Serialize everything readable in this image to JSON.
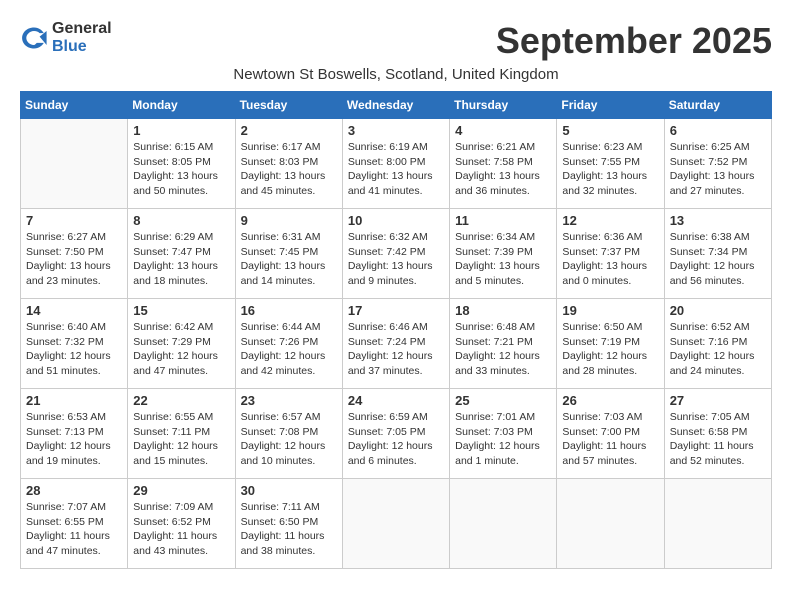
{
  "header": {
    "logo_general": "General",
    "logo_blue": "Blue",
    "month_title": "September 2025",
    "subtitle": "Newtown St Boswells, Scotland, United Kingdom"
  },
  "days_of_week": [
    "Sunday",
    "Monday",
    "Tuesday",
    "Wednesday",
    "Thursday",
    "Friday",
    "Saturday"
  ],
  "weeks": [
    [
      {
        "day": "",
        "info": ""
      },
      {
        "day": "1",
        "info": "Sunrise: 6:15 AM\nSunset: 8:05 PM\nDaylight: 13 hours\nand 50 minutes."
      },
      {
        "day": "2",
        "info": "Sunrise: 6:17 AM\nSunset: 8:03 PM\nDaylight: 13 hours\nand 45 minutes."
      },
      {
        "day": "3",
        "info": "Sunrise: 6:19 AM\nSunset: 8:00 PM\nDaylight: 13 hours\nand 41 minutes."
      },
      {
        "day": "4",
        "info": "Sunrise: 6:21 AM\nSunset: 7:58 PM\nDaylight: 13 hours\nand 36 minutes."
      },
      {
        "day": "5",
        "info": "Sunrise: 6:23 AM\nSunset: 7:55 PM\nDaylight: 13 hours\nand 32 minutes."
      },
      {
        "day": "6",
        "info": "Sunrise: 6:25 AM\nSunset: 7:52 PM\nDaylight: 13 hours\nand 27 minutes."
      }
    ],
    [
      {
        "day": "7",
        "info": "Sunrise: 6:27 AM\nSunset: 7:50 PM\nDaylight: 13 hours\nand 23 minutes."
      },
      {
        "day": "8",
        "info": "Sunrise: 6:29 AM\nSunset: 7:47 PM\nDaylight: 13 hours\nand 18 minutes."
      },
      {
        "day": "9",
        "info": "Sunrise: 6:31 AM\nSunset: 7:45 PM\nDaylight: 13 hours\nand 14 minutes."
      },
      {
        "day": "10",
        "info": "Sunrise: 6:32 AM\nSunset: 7:42 PM\nDaylight: 13 hours\nand 9 minutes."
      },
      {
        "day": "11",
        "info": "Sunrise: 6:34 AM\nSunset: 7:39 PM\nDaylight: 13 hours\nand 5 minutes."
      },
      {
        "day": "12",
        "info": "Sunrise: 6:36 AM\nSunset: 7:37 PM\nDaylight: 13 hours\nand 0 minutes."
      },
      {
        "day": "13",
        "info": "Sunrise: 6:38 AM\nSunset: 7:34 PM\nDaylight: 12 hours\nand 56 minutes."
      }
    ],
    [
      {
        "day": "14",
        "info": "Sunrise: 6:40 AM\nSunset: 7:32 PM\nDaylight: 12 hours\nand 51 minutes."
      },
      {
        "day": "15",
        "info": "Sunrise: 6:42 AM\nSunset: 7:29 PM\nDaylight: 12 hours\nand 47 minutes."
      },
      {
        "day": "16",
        "info": "Sunrise: 6:44 AM\nSunset: 7:26 PM\nDaylight: 12 hours\nand 42 minutes."
      },
      {
        "day": "17",
        "info": "Sunrise: 6:46 AM\nSunset: 7:24 PM\nDaylight: 12 hours\nand 37 minutes."
      },
      {
        "day": "18",
        "info": "Sunrise: 6:48 AM\nSunset: 7:21 PM\nDaylight: 12 hours\nand 33 minutes."
      },
      {
        "day": "19",
        "info": "Sunrise: 6:50 AM\nSunset: 7:19 PM\nDaylight: 12 hours\nand 28 minutes."
      },
      {
        "day": "20",
        "info": "Sunrise: 6:52 AM\nSunset: 7:16 PM\nDaylight: 12 hours\nand 24 minutes."
      }
    ],
    [
      {
        "day": "21",
        "info": "Sunrise: 6:53 AM\nSunset: 7:13 PM\nDaylight: 12 hours\nand 19 minutes."
      },
      {
        "day": "22",
        "info": "Sunrise: 6:55 AM\nSunset: 7:11 PM\nDaylight: 12 hours\nand 15 minutes."
      },
      {
        "day": "23",
        "info": "Sunrise: 6:57 AM\nSunset: 7:08 PM\nDaylight: 12 hours\nand 10 minutes."
      },
      {
        "day": "24",
        "info": "Sunrise: 6:59 AM\nSunset: 7:05 PM\nDaylight: 12 hours\nand 6 minutes."
      },
      {
        "day": "25",
        "info": "Sunrise: 7:01 AM\nSunset: 7:03 PM\nDaylight: 12 hours\nand 1 minute."
      },
      {
        "day": "26",
        "info": "Sunrise: 7:03 AM\nSunset: 7:00 PM\nDaylight: 11 hours\nand 57 minutes."
      },
      {
        "day": "27",
        "info": "Sunrise: 7:05 AM\nSunset: 6:58 PM\nDaylight: 11 hours\nand 52 minutes."
      }
    ],
    [
      {
        "day": "28",
        "info": "Sunrise: 7:07 AM\nSunset: 6:55 PM\nDaylight: 11 hours\nand 47 minutes."
      },
      {
        "day": "29",
        "info": "Sunrise: 7:09 AM\nSunset: 6:52 PM\nDaylight: 11 hours\nand 43 minutes."
      },
      {
        "day": "30",
        "info": "Sunrise: 7:11 AM\nSunset: 6:50 PM\nDaylight: 11 hours\nand 38 minutes."
      },
      {
        "day": "",
        "info": ""
      },
      {
        "day": "",
        "info": ""
      },
      {
        "day": "",
        "info": ""
      },
      {
        "day": "",
        "info": ""
      }
    ]
  ]
}
